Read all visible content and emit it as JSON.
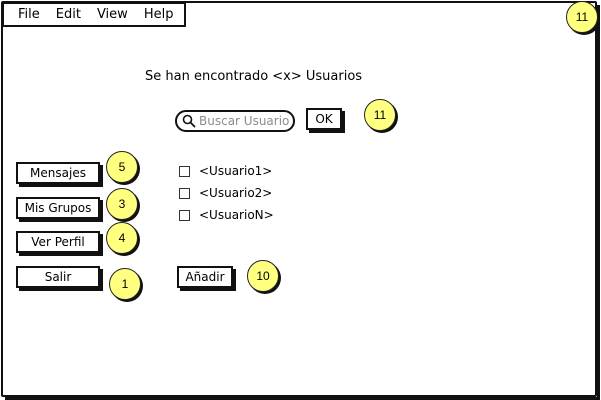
{
  "menu": {
    "items": [
      "File",
      "Edit",
      "View",
      "Help"
    ]
  },
  "main": {
    "found_text": "Se han encontrado <x> Usuarios",
    "search": {
      "placeholder": "Buscar Usuario",
      "value": ""
    },
    "ok_label": "OK",
    "users": [
      {
        "label": "<Usuario1>",
        "checked": false
      },
      {
        "label": "<Usuario2>",
        "checked": false
      },
      {
        "label": "<UsuarioN>",
        "checked": false
      }
    ],
    "add_label": "Añadir"
  },
  "sidebar": {
    "buttons": [
      {
        "label": "Mensajes"
      },
      {
        "label": "Mis Grupos"
      },
      {
        "label": "Ver Perfil"
      },
      {
        "label": "Salir"
      }
    ]
  },
  "annotations": {
    "top_right": "11",
    "ok": "11",
    "mensajes": "5",
    "mis_grupos": "3",
    "ver_perfil": "4",
    "salir": "1",
    "anadir": "10",
    "color": "#ffff80"
  },
  "icons": {
    "search": "search-icon"
  }
}
